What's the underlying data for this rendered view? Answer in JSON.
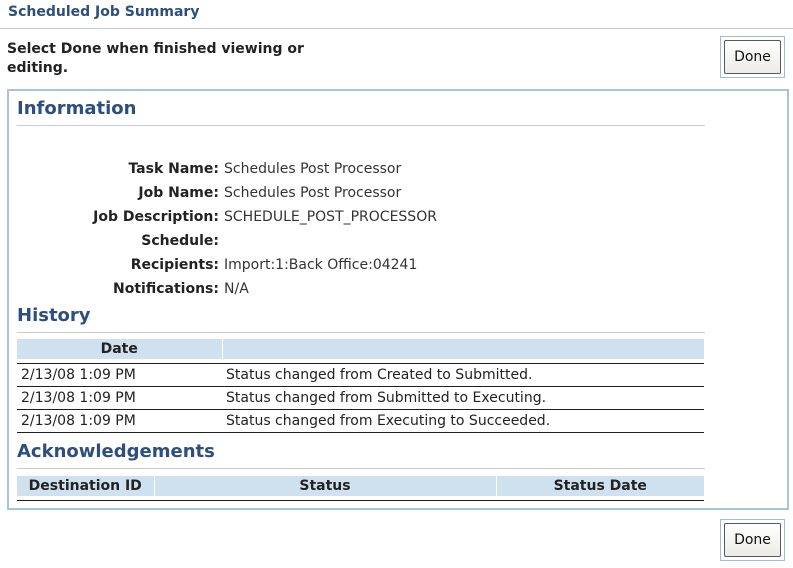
{
  "page": {
    "title": "Scheduled Job Summary",
    "instructions": "Select Done when finished viewing or editing.",
    "done_label": "Done"
  },
  "information": {
    "heading": "Information",
    "fields": [
      {
        "label": "Task Name:",
        "value": "Schedules Post Processor"
      },
      {
        "label": "Job Name:",
        "value": "Schedules Post Processor"
      },
      {
        "label": "Job Description:",
        "value": "SCHEDULE_POST_PROCESSOR"
      },
      {
        "label": "Schedule:",
        "value": ""
      },
      {
        "label": "Recipients:",
        "value": "Import:1:Back Office:04241"
      },
      {
        "label": "Notifications:",
        "value": "N/A"
      }
    ]
  },
  "history": {
    "heading": "History",
    "columns": [
      "Date",
      ""
    ],
    "rows": [
      {
        "date": "2/13/08 1:09 PM",
        "text": "Status changed from Created to Submitted."
      },
      {
        "date": "2/13/08 1:09 PM",
        "text": "Status changed from Submitted to Executing."
      },
      {
        "date": "2/13/08 1:09 PM",
        "text": "Status changed from Executing to Succeeded."
      }
    ]
  },
  "acknowledgements": {
    "heading": "Acknowledgements",
    "columns": [
      "Destination ID",
      "Status",
      "Status Date"
    ]
  },
  "colors": {
    "heading": "#2d4f7f",
    "table_header": "#cfe0ef",
    "frame_border": "#a9c4d8"
  }
}
